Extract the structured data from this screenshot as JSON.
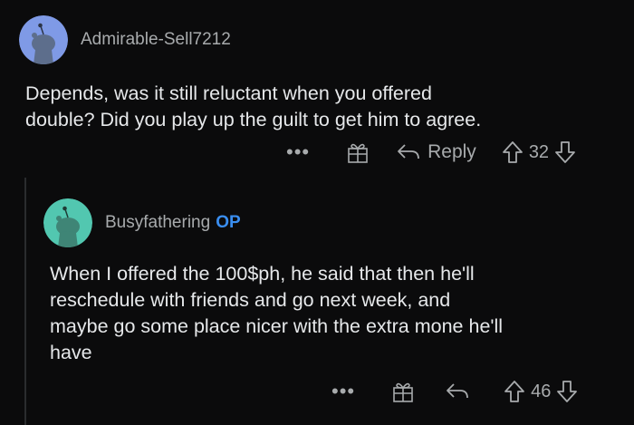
{
  "comments": [
    {
      "username": "Admirable-Sell7212",
      "op_badge": "",
      "avatar_color": "#7f9ae6",
      "body_lines": [
        "Depends, was it still reluctant when you offered",
        "double? Did you play up the guilt to get him to agree."
      ],
      "actions": {
        "more": "•••",
        "award_icon": "gift-icon",
        "reply_label": "Reply",
        "votes": "32"
      }
    },
    {
      "username": "Busyfathering",
      "op_badge": "OP",
      "avatar_color": "#52c7b0",
      "body_lines": [
        "When I offered the 100$ph, he said that then he'll",
        "reschedule with friends and go next week, and",
        "maybe go some place nicer with the extra mone he'll",
        "have"
      ],
      "actions": {
        "more": "•••",
        "award_icon": "gift-icon",
        "reply_label": "",
        "votes": "46"
      }
    }
  ],
  "colors": {
    "background": "#0b0b0c",
    "text": "#e6e8ea",
    "muted": "#a8abad",
    "op": "#3a8ef0"
  }
}
